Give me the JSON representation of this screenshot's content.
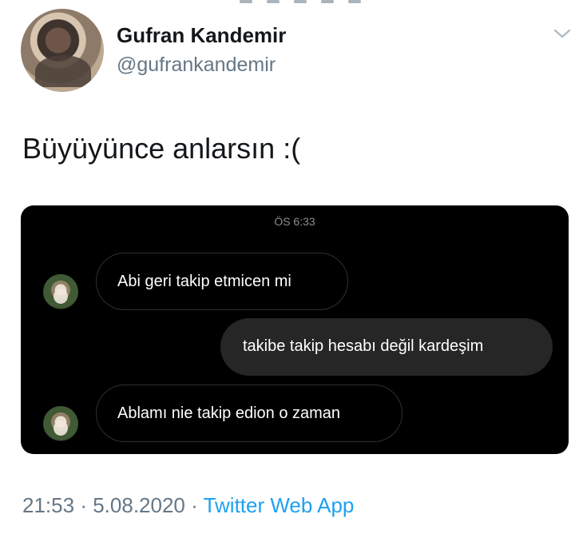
{
  "header": {
    "display_name": "Gufran Kandemir",
    "handle": "@gufrankandemir",
    "avatar_icon": "profile-photo-icon",
    "menu_icon": "chevron-down-icon"
  },
  "tweet": {
    "text": "Büyüyünce anlarsın :("
  },
  "dm_screenshot": {
    "time": "ÖS 6:33",
    "messages": [
      {
        "direction": "incoming",
        "text": "Abi geri takip etmicen mi"
      },
      {
        "direction": "outgoing",
        "text": "takibe takip hesabı değil kardeşim"
      },
      {
        "direction": "incoming",
        "text": "Ablamı nie takip edion o zaman"
      }
    ]
  },
  "footer": {
    "time": "21:53",
    "separator": "·",
    "date": "5.08.2020",
    "source": "Twitter Web App"
  },
  "colors": {
    "text": "#14171a",
    "muted": "#657786",
    "accent": "#1da1f2",
    "dm_background": "#000000",
    "dm_outgoing_bubble": "#262626"
  }
}
